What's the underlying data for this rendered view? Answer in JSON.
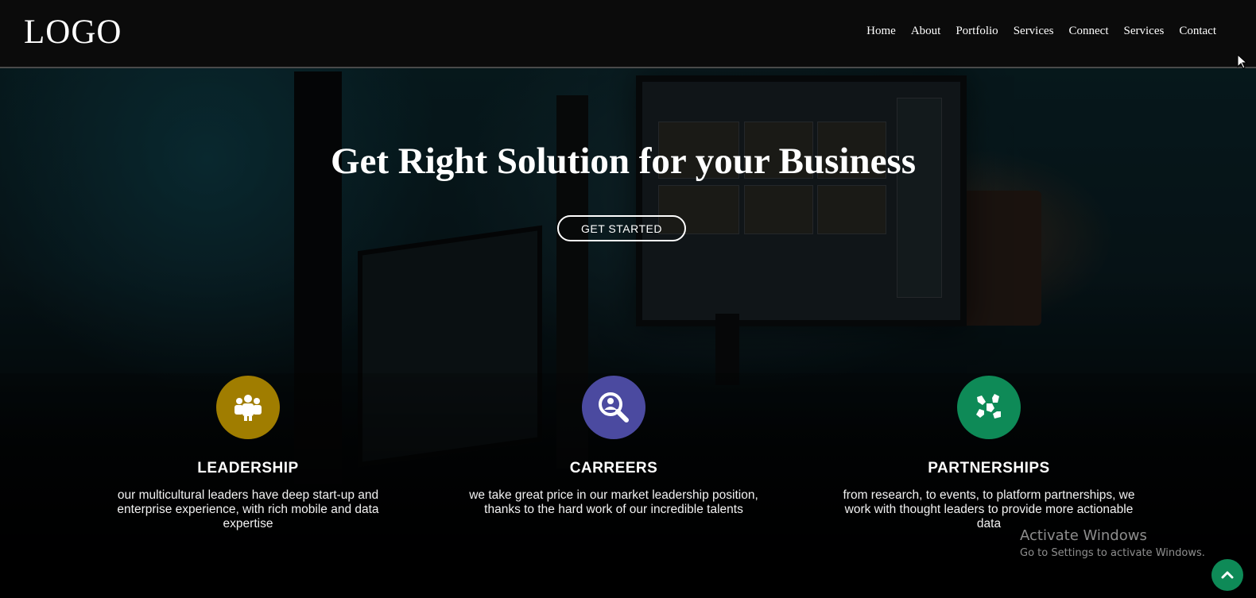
{
  "navbar": {
    "logo": "LOGO",
    "links": [
      {
        "label": "Home"
      },
      {
        "label": "About"
      },
      {
        "label": "Portfolio"
      },
      {
        "label": "Services"
      },
      {
        "label": "Connect"
      },
      {
        "label": "Services"
      },
      {
        "label": "Contact"
      }
    ]
  },
  "hero": {
    "title": "Get Right Solution for your Business",
    "cta_label": "GET STARTED"
  },
  "features": [
    {
      "icon": "group-people-icon",
      "icon_color": "#a07d00",
      "title": "LEADERSHIP",
      "description": "our multicultural leaders have deep start-up and enterprise experience, with rich mobile and data expertise"
    },
    {
      "icon": "search-person-icon",
      "icon_color": "#4b4aa0",
      "title": "CARREERS",
      "description": "we take great price in our market leadership position, thanks to the hard work of our incredible talents"
    },
    {
      "icon": "hands-partnership-icon",
      "icon_color": "#0e8a57",
      "title": "PARTNERSHIPS",
      "description": "from research, to events, to platform partnerships, we work with thought leaders to provide more actionable data"
    }
  ],
  "watermark": {
    "title": "Activate Windows",
    "subtitle": "Go to Settings to activate Windows."
  },
  "scroll_top": {
    "icon": "chevron-up-icon",
    "color": "#0e8a57"
  }
}
